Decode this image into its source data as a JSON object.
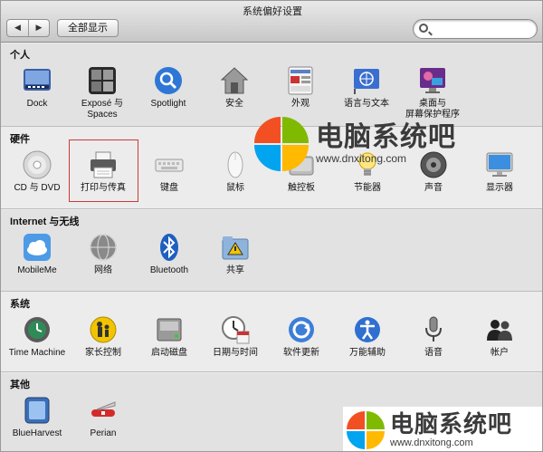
{
  "window": {
    "title": "系统偏好设置"
  },
  "toolbar": {
    "back_icon": "back-arrow-icon",
    "forward_icon": "forward-arrow-icon",
    "back_glyph": "◀",
    "forward_glyph": "▶",
    "show_all_label": "全部显示",
    "search_value": "",
    "search_placeholder": ""
  },
  "sections": [
    {
      "title": "个人",
      "items": [
        {
          "label": "Dock",
          "icon": "dock-icon"
        },
        {
          "label": "Exposé 与\nSpaces",
          "icon": "expose-icon"
        },
        {
          "label": "Spotlight",
          "icon": "spotlight-icon"
        },
        {
          "label": "安全",
          "icon": "security-house-icon"
        },
        {
          "label": "外观",
          "icon": "appearance-icon"
        },
        {
          "label": "语言与文本",
          "icon": "language-flag-icon"
        },
        {
          "label": "桌面与\n屏幕保护程序",
          "icon": "desktop-screensaver-icon"
        }
      ]
    },
    {
      "title": "硬件",
      "items": [
        {
          "label": "CD 与 DVD",
          "icon": "cd-dvd-icon"
        },
        {
          "label": "打印与传真",
          "icon": "printer-icon"
        },
        {
          "label": "键盘",
          "icon": "keyboard-icon"
        },
        {
          "label": "鼠标",
          "icon": "mouse-icon"
        },
        {
          "label": "触控板",
          "icon": "trackpad-icon"
        },
        {
          "label": "节能器",
          "icon": "energy-saver-bulb-icon"
        },
        {
          "label": "声音",
          "icon": "sound-speaker-icon"
        },
        {
          "label": "显示器",
          "icon": "display-icon"
        }
      ]
    },
    {
      "title": "Internet 与无线",
      "items": [
        {
          "label": "MobileMe",
          "icon": "mobileme-cloud-icon"
        },
        {
          "label": "网络",
          "icon": "network-globe-icon"
        },
        {
          "label": "Bluetooth",
          "icon": "bluetooth-icon"
        },
        {
          "label": "共享",
          "icon": "sharing-folder-icon"
        }
      ]
    },
    {
      "title": "系统",
      "items": [
        {
          "label": "Time Machine",
          "icon": "time-machine-icon"
        },
        {
          "label": "家长控制",
          "icon": "parental-controls-icon"
        },
        {
          "label": "启动磁盘",
          "icon": "startup-disk-icon"
        },
        {
          "label": "日期与时间",
          "icon": "date-time-clock-icon"
        },
        {
          "label": "软件更新",
          "icon": "software-update-icon"
        },
        {
          "label": "万能辅助",
          "icon": "universal-access-icon"
        },
        {
          "label": "语音",
          "icon": "speech-microphone-icon"
        },
        {
          "label": "帐户",
          "icon": "accounts-people-icon"
        }
      ]
    },
    {
      "title": "其他",
      "items": [
        {
          "label": "BlueHarvest",
          "icon": "blueharvest-icon"
        },
        {
          "label": "Perian",
          "icon": "perian-knife-icon"
        }
      ]
    }
  ],
  "colors": {
    "highlight_box": "#cc3a3a",
    "win_red": "#f25022",
    "win_green": "#7fba00",
    "win_blue": "#00a4ef",
    "win_yellow": "#ffb900"
  },
  "watermark": {
    "name": "电脑系统吧",
    "url": "www.dnxitong.com"
  }
}
